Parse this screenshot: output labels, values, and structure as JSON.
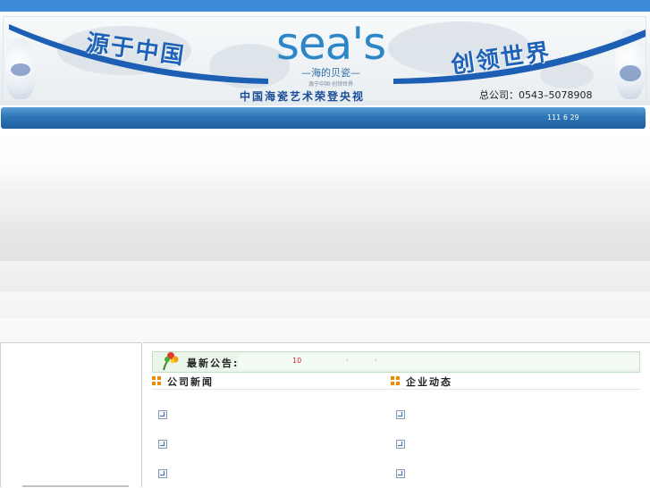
{
  "banner": {
    "slogan_left": "源于中国",
    "slogan_right": "创领世界",
    "logo": "sea's",
    "logo_subtitle": "—海的贝瓷—",
    "logo_tagline": "源于中国·创领世界",
    "caption": "中国海瓷艺术荣登央视",
    "phone": "总公司：0543–5078908"
  },
  "navbar": {
    "date": "111 6 29"
  },
  "notice": {
    "label": "最新公告:",
    "text": "10",
    "dot1": "·",
    "dot2": "·"
  },
  "columns": {
    "company_news": "公司新闻",
    "enterprise_news": "企业动态"
  },
  "colors": {
    "topbar": "#3c8ad8",
    "navbar": "#2d74b6",
    "accent_orange": "#f08a00",
    "notice_red": "#cc1f1f"
  }
}
